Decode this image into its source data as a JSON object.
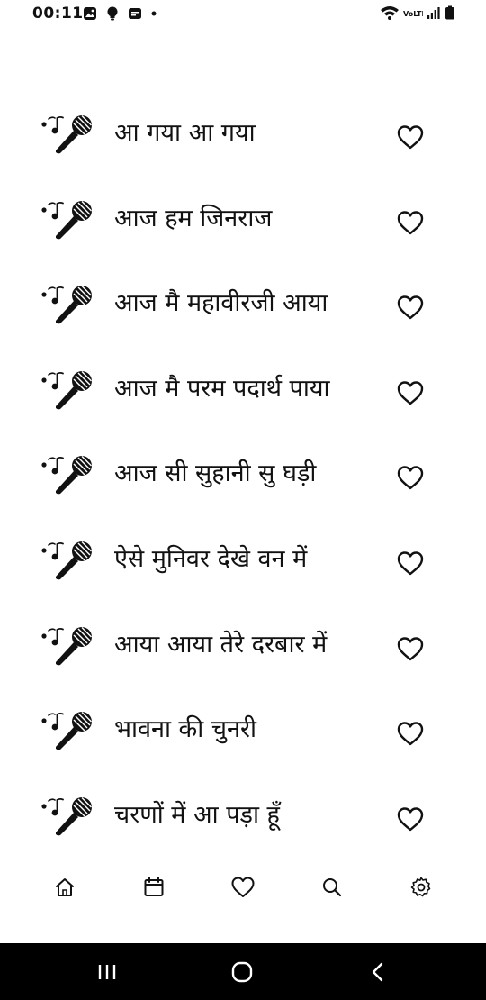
{
  "status_bar": {
    "time": "00:11",
    "left_icons": [
      "gallery-icon",
      "bulb-icon",
      "message-icon",
      "dot-icon"
    ],
    "right_icons": [
      "wifi-icon",
      "volte-icon",
      "signal-icon",
      "battery-icon"
    ],
    "volte_label": "VoLTE"
  },
  "songs": [
    {
      "title": "आ गया आ गया"
    },
    {
      "title": "आज हम जिनराज"
    },
    {
      "title": "आज मै महावीरजी आया"
    },
    {
      "title": "आज मै परम पदार्थ पाया"
    },
    {
      "title": "आज सी सुहानी सु घड़ी"
    },
    {
      "title": "ऐसे मुनिवर देखे वन में"
    },
    {
      "title": "आया आया तेरे दरबार में"
    },
    {
      "title": "भावना की चुनरी"
    },
    {
      "title": "चरणों में आ पड़ा हूँ"
    }
  ],
  "tab_bar": {
    "tabs": [
      "home-icon",
      "calendar-icon",
      "heart-icon",
      "search-icon",
      "settings-icon"
    ]
  },
  "nav_bar": {
    "buttons": [
      "recent-apps-icon",
      "home-button-icon",
      "back-icon"
    ]
  }
}
